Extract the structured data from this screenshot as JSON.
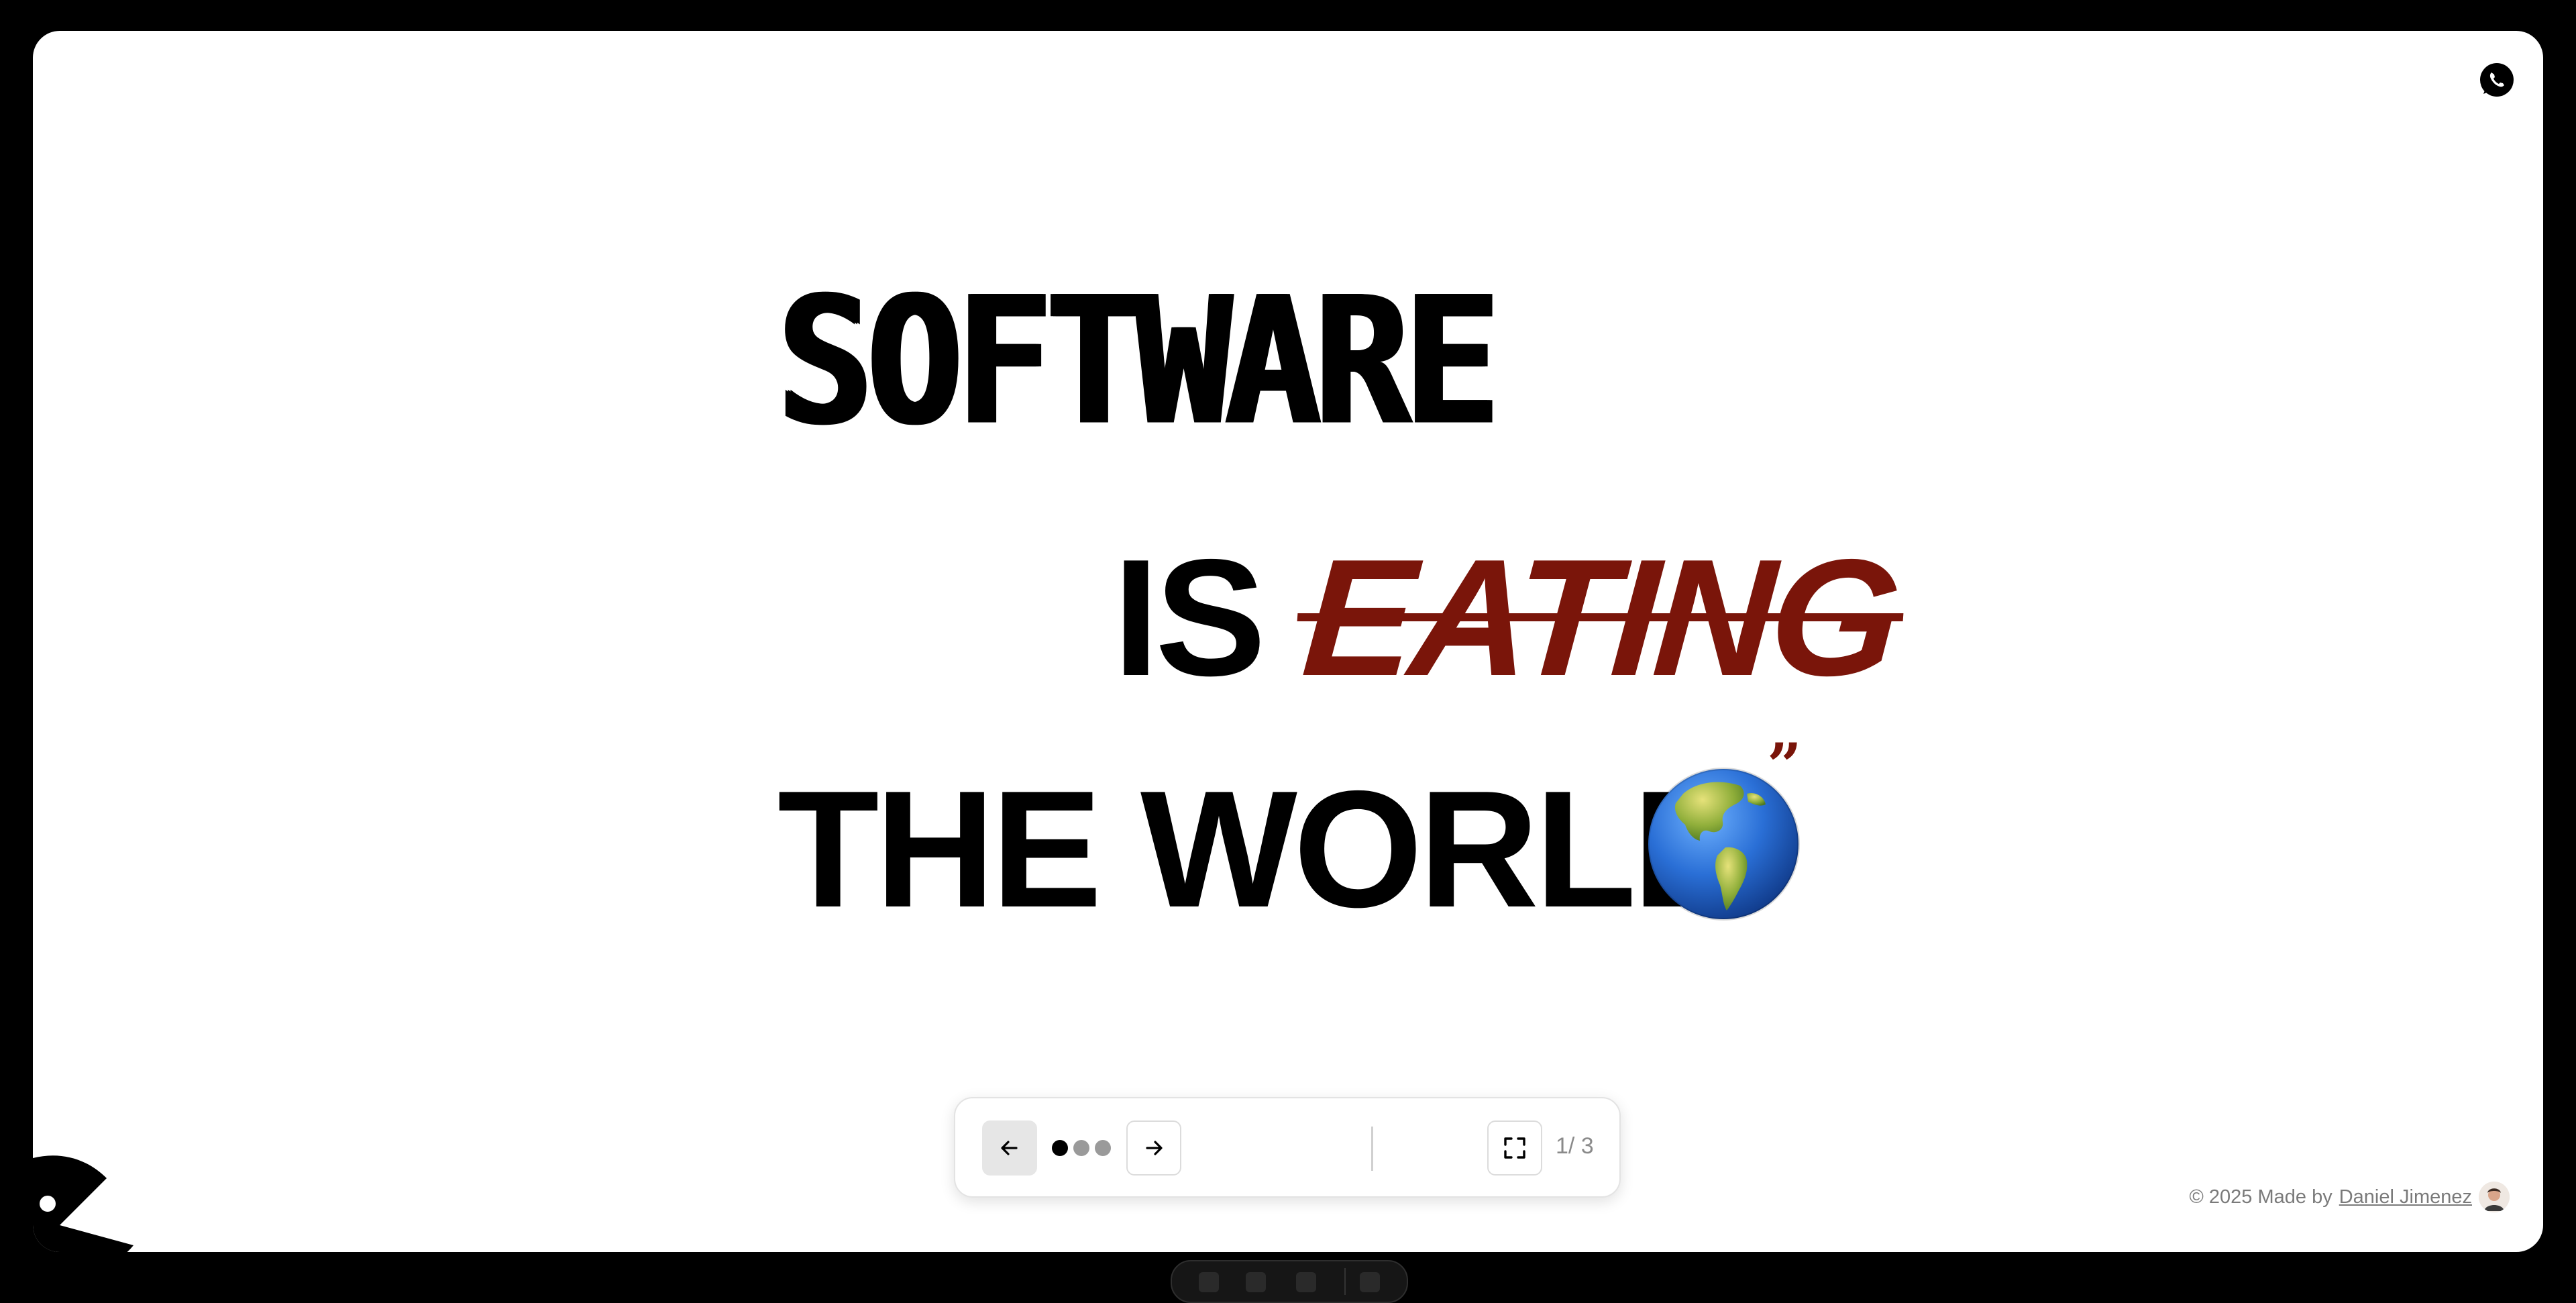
{
  "hero": {
    "line1": "SOFTWARE",
    "line2_is": "IS",
    "line2_eating": "EATING",
    "line3": "THE WORLD",
    "quote_mark": "”",
    "globe_emoji": "earth-americas"
  },
  "controls": {
    "prev_icon": "arrow-left-icon",
    "next_icon": "arrow-right-icon",
    "fullscreen_icon": "fullscreen-icon",
    "dots": [
      {
        "state": "active"
      },
      {
        "state": "inactive"
      },
      {
        "state": "inactive"
      }
    ],
    "page_counter": "1/ 3"
  },
  "footer": {
    "copyright": "© 2025 Made by",
    "author": "Daniel Jimenez"
  },
  "colors": {
    "accent": "#7a150a",
    "frame_bg": "#ffffff",
    "page_bg": "#000000"
  }
}
